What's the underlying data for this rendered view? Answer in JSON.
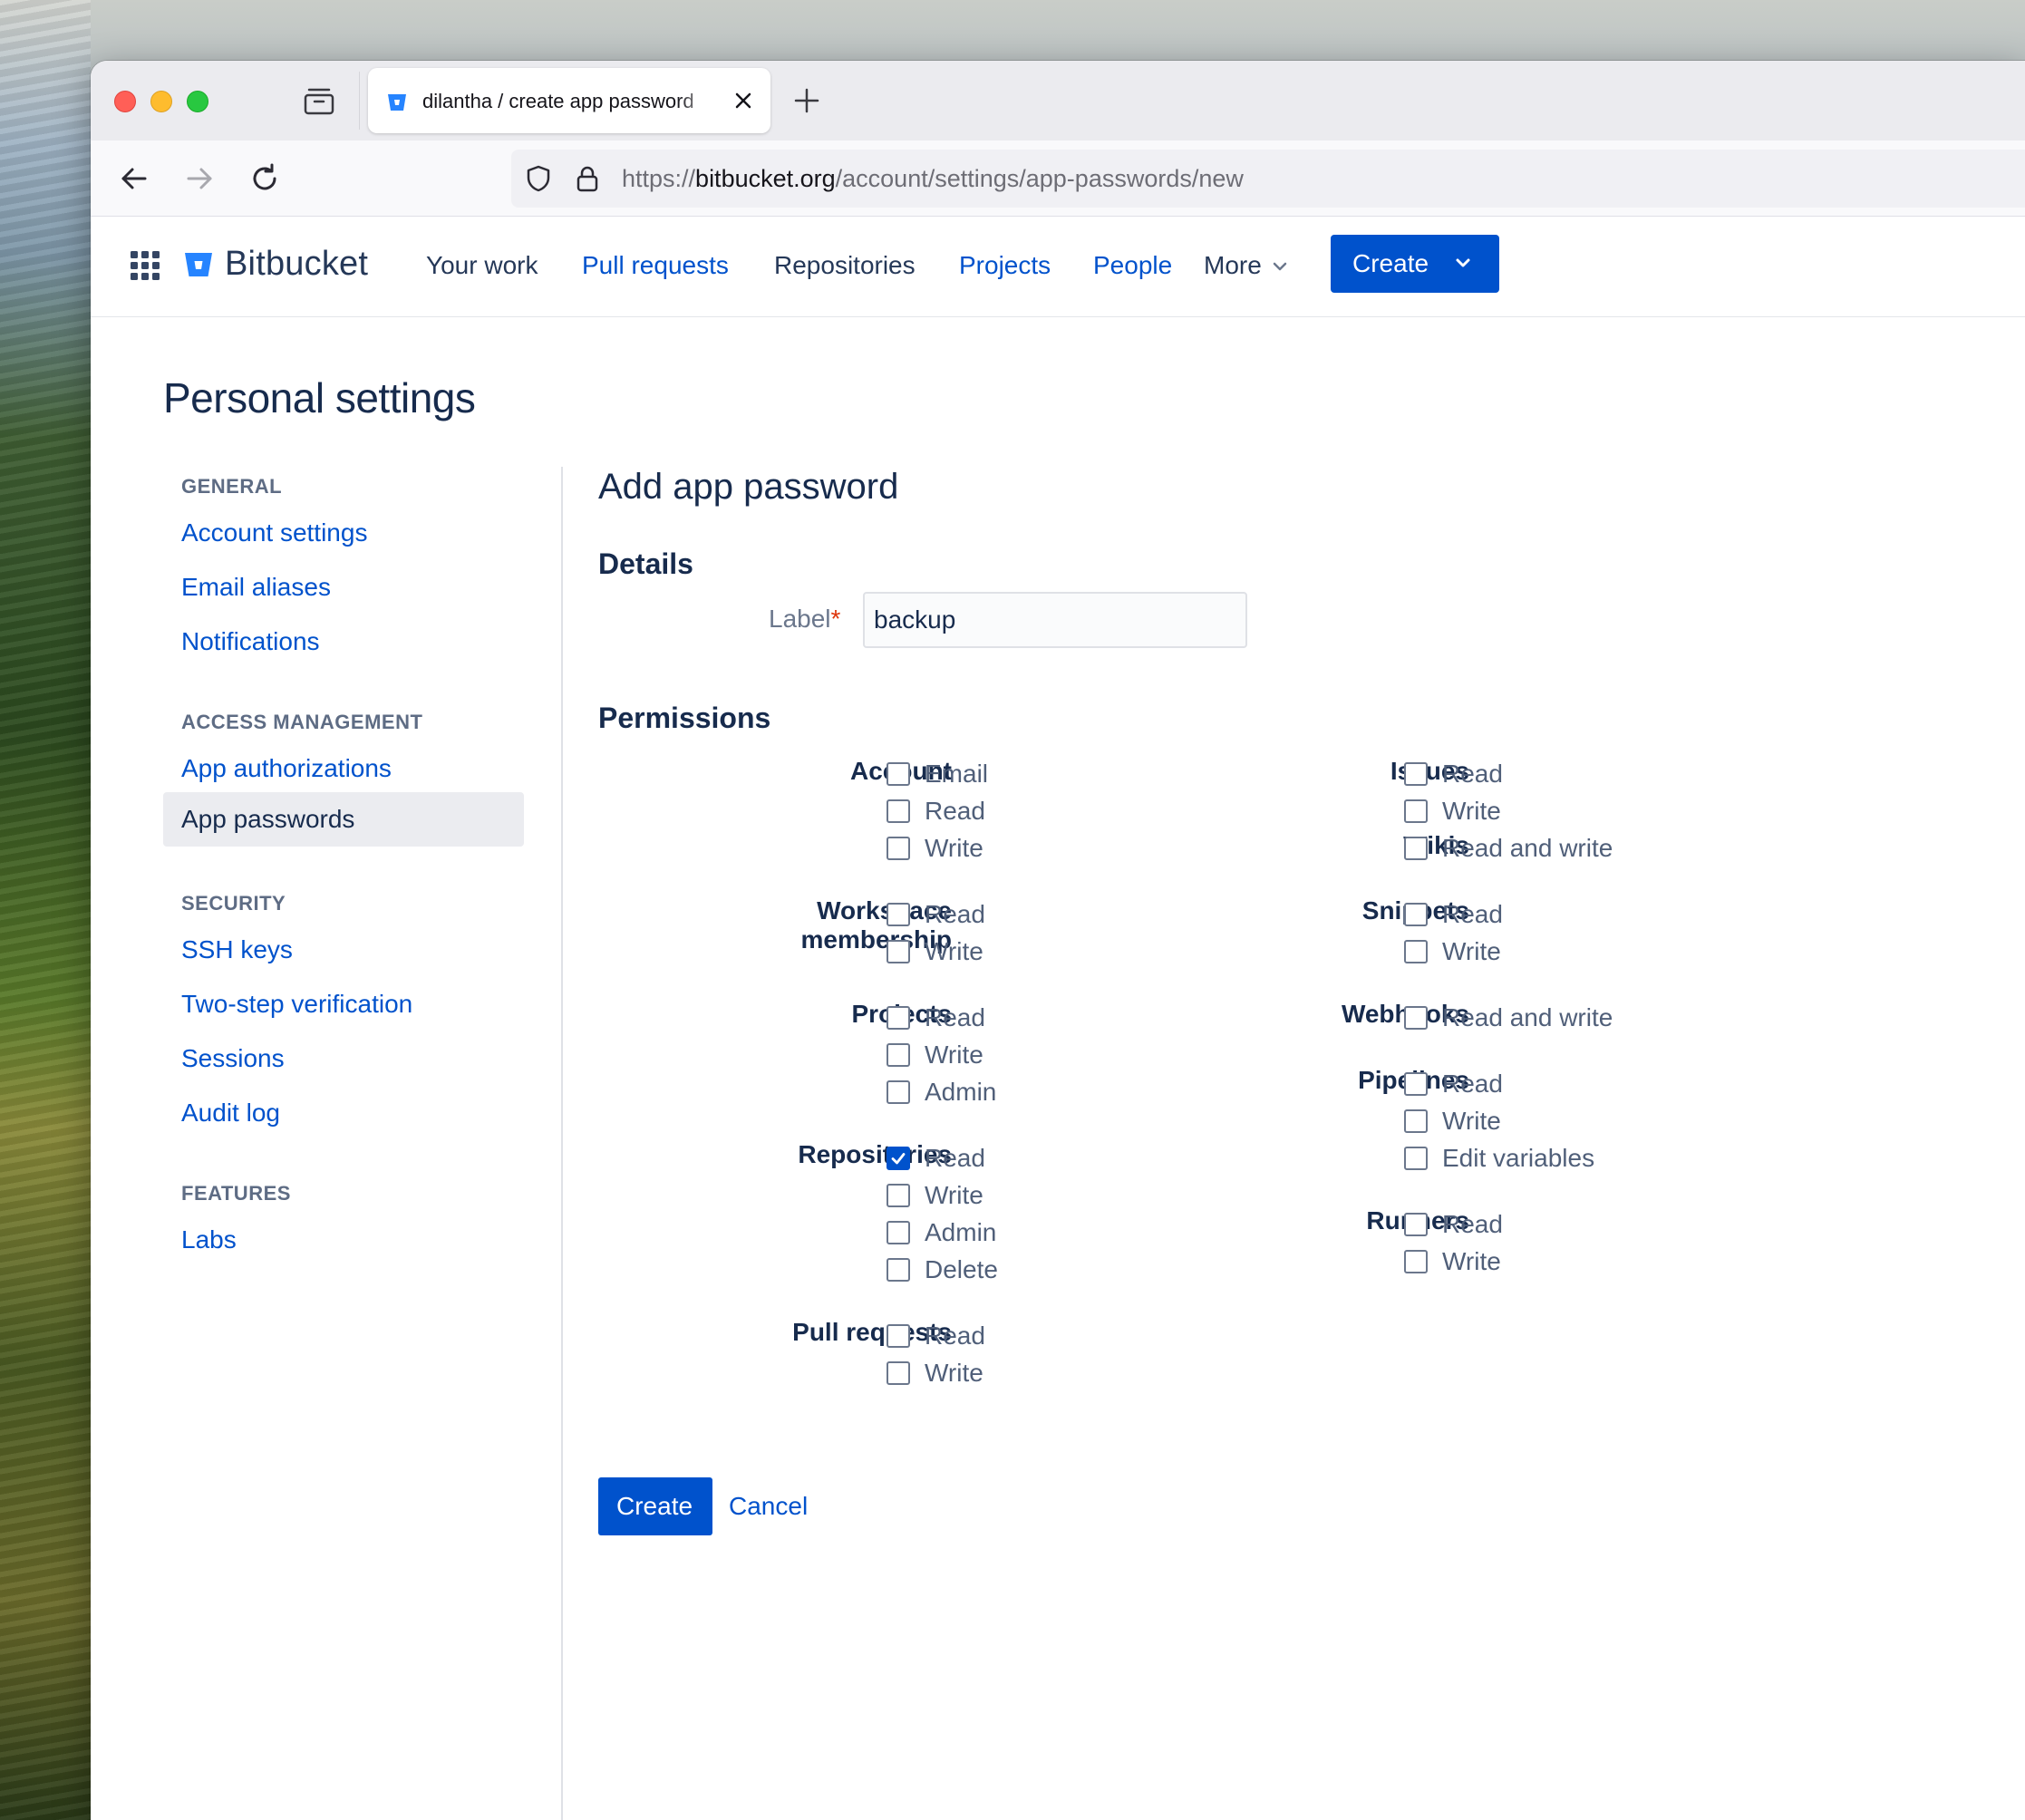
{
  "browser": {
    "tab_title": "dilantha / create app password",
    "url_scheme": "https://",
    "url_host": "bitbucket.org",
    "url_path": "/account/settings/app-passwords/new"
  },
  "header": {
    "brand": "Bitbucket",
    "nav": [
      "Your work",
      "Pull requests",
      "Repositories",
      "Projects",
      "People",
      "More"
    ],
    "create_label": "Create"
  },
  "page": {
    "title": "Personal settings"
  },
  "sidebar": {
    "general_heading": "GENERAL",
    "general": [
      "Account settings",
      "Email aliases",
      "Notifications"
    ],
    "access_heading": "ACCESS MANAGEMENT",
    "access": [
      "App authorizations",
      "App passwords"
    ],
    "security_heading": "SECURITY",
    "security": [
      "SSH keys",
      "Two-step verification",
      "Sessions",
      "Audit log"
    ],
    "features_heading": "FEATURES",
    "features": [
      "Labs"
    ]
  },
  "form": {
    "title": "Add app password",
    "details_heading": "Details",
    "label_field_label": "Label",
    "required_marker": "*",
    "label_value": "backup",
    "permissions_heading": "Permissions",
    "groups": {
      "account": {
        "name": "Account",
        "options": [
          "Email",
          "Read",
          "Write"
        ]
      },
      "workspace": {
        "name_line1": "Workspace",
        "name_line2": "membership",
        "options": [
          "Read",
          "Write"
        ]
      },
      "projects": {
        "name": "Projects",
        "options": [
          "Read",
          "Write",
          "Admin"
        ]
      },
      "repositories": {
        "name": "Repositories",
        "options": [
          "Read",
          "Write",
          "Admin",
          "Delete"
        ],
        "checked": [
          "Read"
        ]
      },
      "pullrequests": {
        "name": "Pull requests",
        "options": [
          "Read",
          "Write"
        ]
      },
      "issues": {
        "name": "Issues",
        "options": [
          "Read",
          "Write"
        ]
      },
      "wikis": {
        "name": "Wikis",
        "options": [
          "Read and write"
        ]
      },
      "snippets": {
        "name": "Snippets",
        "options": [
          "Read",
          "Write"
        ]
      },
      "webhooks": {
        "name": "Webhooks",
        "options": [
          "Read and write"
        ]
      },
      "pipelines": {
        "name": "Pipelines",
        "options": [
          "Read",
          "Write",
          "Edit variables"
        ]
      },
      "runners": {
        "name": "Runners",
        "options": [
          "Read",
          "Write"
        ]
      }
    },
    "create_label": "Create",
    "cancel_label": "Cancel"
  },
  "colors": {
    "brand_blue": "#0052cc",
    "text_dark": "#172b4d",
    "required_red": "#de350b"
  }
}
